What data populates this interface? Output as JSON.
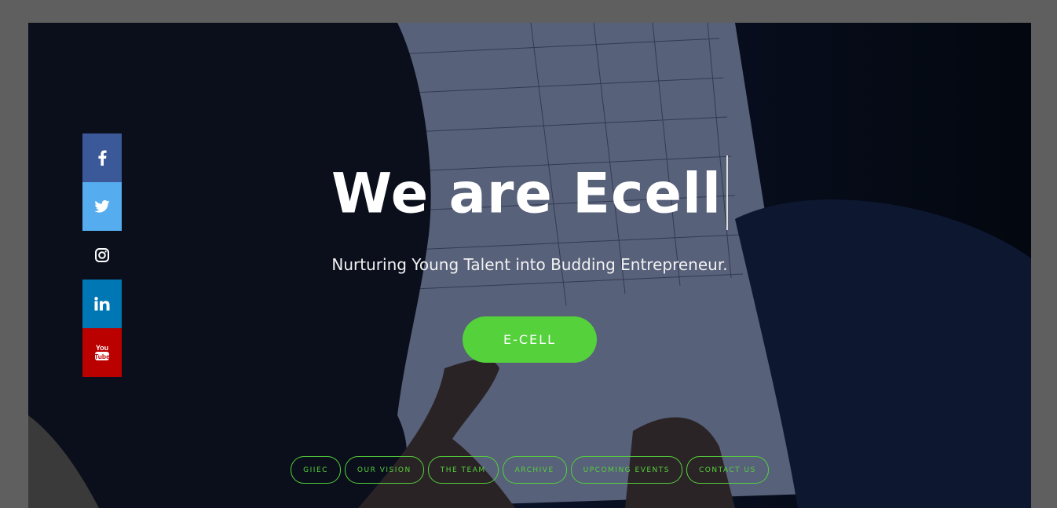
{
  "hero": {
    "title": "We are Ecell",
    "subtitle": "Nurturing Young Talent into Budding Entrepreneur.",
    "cta_label": "E-CELL"
  },
  "social": [
    {
      "name": "facebook-icon",
      "glyph": "f"
    },
    {
      "name": "twitter-icon",
      "glyph": "twitter"
    },
    {
      "name": "instagram-icon",
      "glyph": "instagram"
    },
    {
      "name": "linkedin-icon",
      "glyph": "in"
    },
    {
      "name": "youtube-icon",
      "glyph": "You Tube"
    }
  ],
  "nav": {
    "items": [
      {
        "label": "GIIEC"
      },
      {
        "label": "OUR VISION"
      },
      {
        "label": "THE TEAM"
      },
      {
        "label": "ARCHIVE"
      },
      {
        "label": "UPCOMING EVENTS"
      },
      {
        "label": "CONTACT US"
      }
    ]
  },
  "colors": {
    "accent": "#54d13b",
    "facebook": "#3b5998",
    "twitter": "#55acee",
    "linkedin": "#0077b5",
    "youtube": "#bb0000",
    "overlay": "#5f5f5f"
  }
}
